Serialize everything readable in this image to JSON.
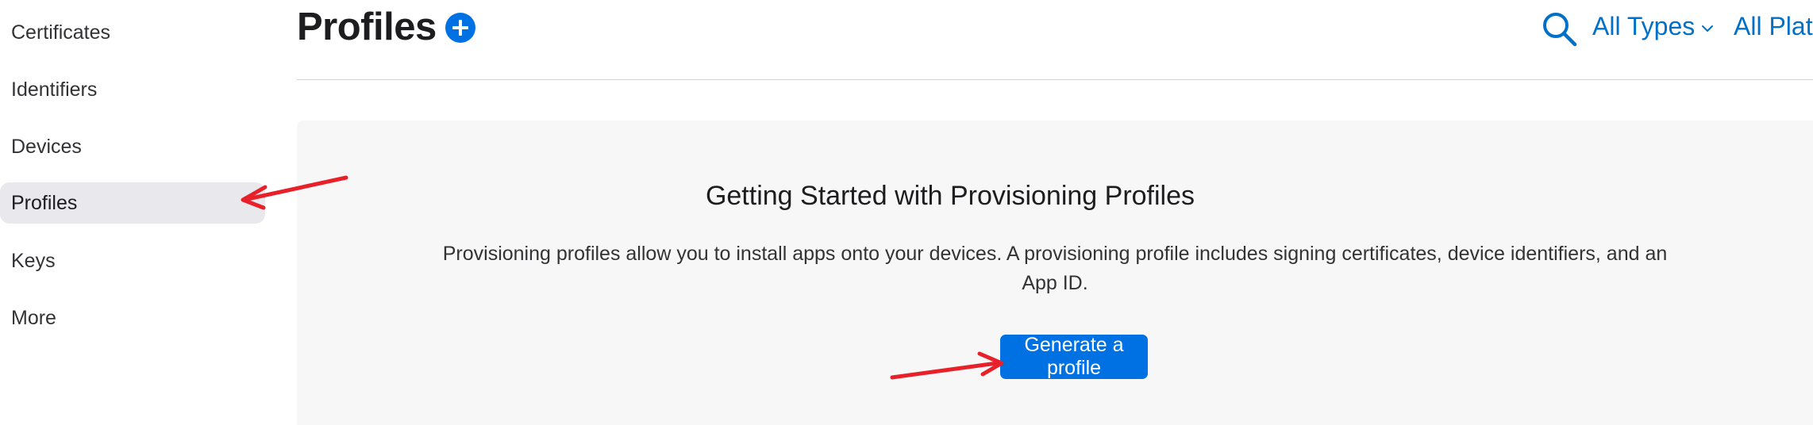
{
  "sidebar": {
    "items": [
      {
        "label": "Certificates"
      },
      {
        "label": "Identifiers"
      },
      {
        "label": "Devices"
      },
      {
        "label": "Profiles",
        "active": true
      },
      {
        "label": "Keys"
      },
      {
        "label": "More"
      }
    ]
  },
  "header": {
    "title": "Profiles",
    "add_icon": "plus-circle-icon",
    "search_icon": "search-icon",
    "types_filter": "All Types",
    "platforms_filter": "All Platforms"
  },
  "main": {
    "heading": "Getting Started with Provisioning Profiles",
    "description": "Provisioning profiles allow you to install apps onto your devices. A provisioning profile includes signing certificates, device identifiers, and an App ID.",
    "generate_button": "Generate a profile"
  },
  "annotations": {
    "arrow_color": "#e8202a",
    "arrow_icon": "red-arrow-icon"
  },
  "colors": {
    "accent": "#0071e3",
    "link": "#0070c9",
    "card_background": "#f7f7f7",
    "active_item_background": "#e8e8ed"
  }
}
